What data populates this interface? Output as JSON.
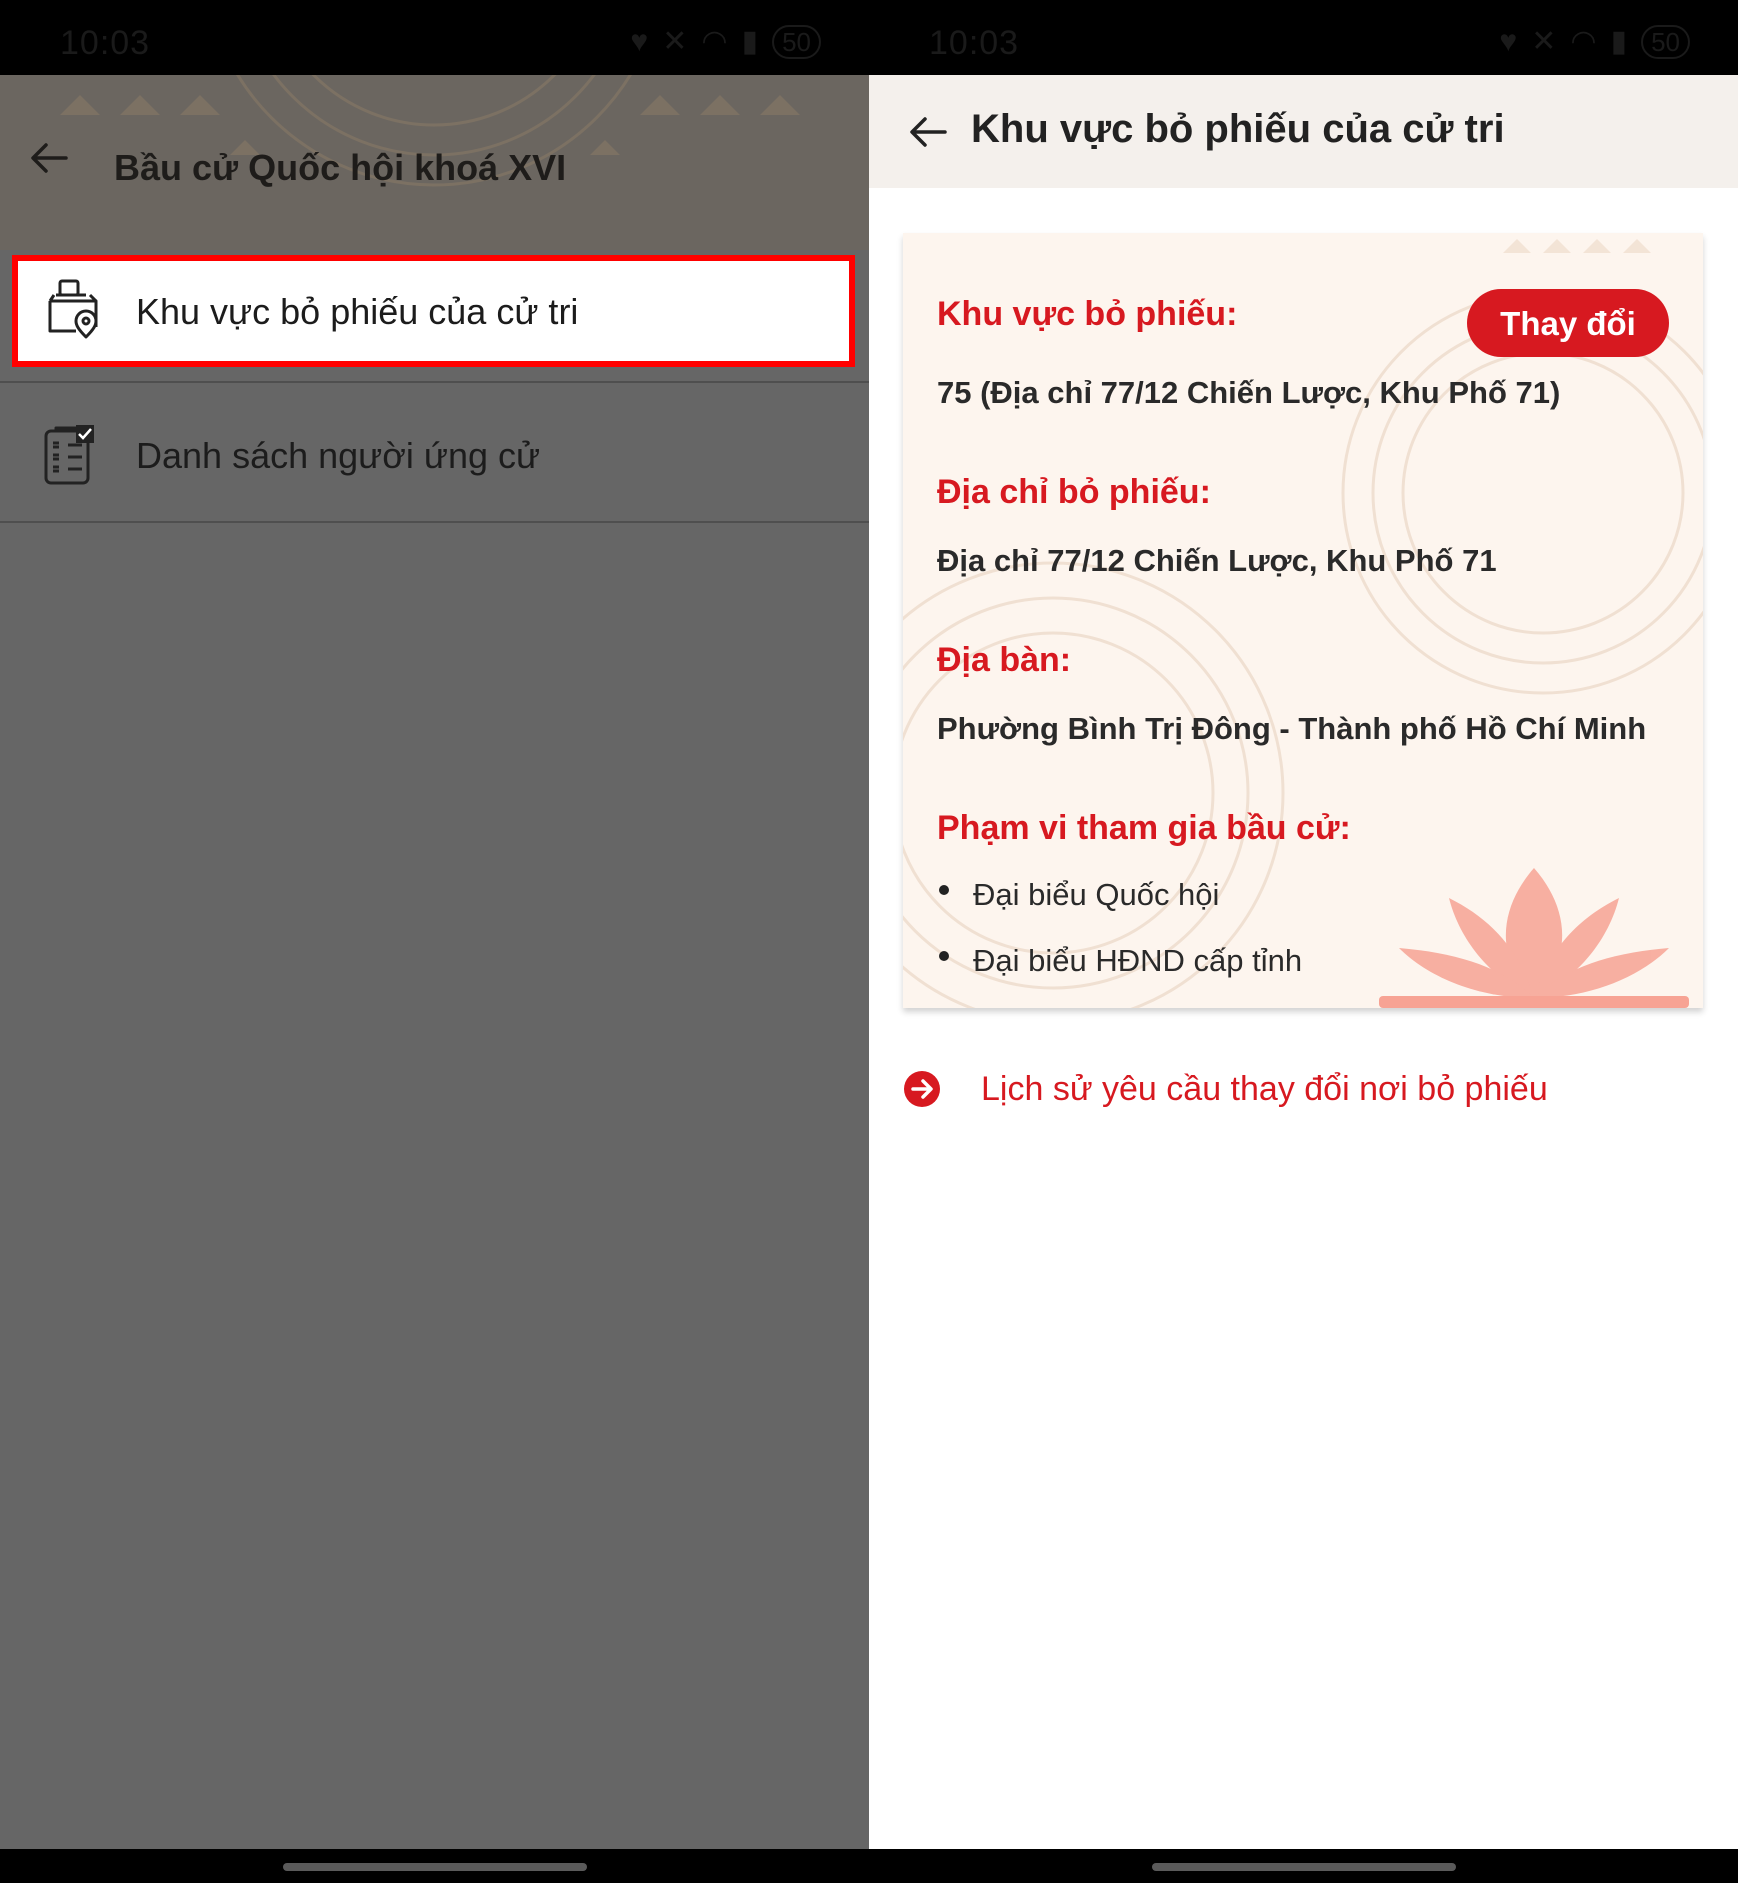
{
  "status_bar": {
    "time": "10:03",
    "battery": "50"
  },
  "left_screen": {
    "header": {
      "title": "Bầu cử Quốc hội khoá XVI"
    },
    "menu_items": [
      {
        "label": "Khu vực bỏ phiếu của cử tri",
        "icon": "ballot-box-location-icon",
        "highlighted": true
      },
      {
        "label": "Danh sách người ứng cử",
        "icon": "candidate-list-icon",
        "highlighted": false
      }
    ]
  },
  "right_screen": {
    "header": {
      "title": "Khu vực bỏ phiếu của cử tri"
    },
    "card": {
      "voting_area_label": "Khu vực bỏ phiếu:",
      "change_button": "Thay đổi",
      "voting_area_value": "75 (Địa chỉ 77/12 Chiến Lược, Khu Phố 71)",
      "voting_address_label": "Địa chỉ bỏ phiếu:",
      "voting_address_value": "Địa chỉ 77/12 Chiến Lược, Khu Phố 71",
      "locality_label": "Địa bàn:",
      "locality_value": "Phường Bình Trị Đông - Thành phố Hồ Chí Minh",
      "scope_label": "Phạm vi tham gia bầu cử:",
      "scope_items": [
        "Đại biểu Quốc hội",
        "Đại biểu HĐND cấp tỉnh"
      ]
    },
    "history_link": "Lịch sử yêu cầu thay đổi nơi bỏ phiếu"
  },
  "colors": {
    "accent_red": "#d71920",
    "highlight_border": "#ff0000",
    "overlay_gray": "#666666",
    "card_bg": "#fdf5ee",
    "lotus_pink": "#f7a394"
  }
}
